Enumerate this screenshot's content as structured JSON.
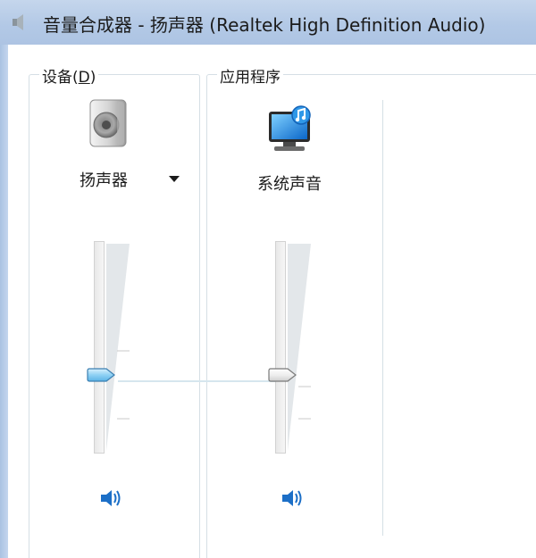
{
  "window": {
    "title": "音量合成器 - 扬声器 (Realtek High Definition Audio)"
  },
  "devices_group": {
    "label": "设备",
    "accelerator_open": "(",
    "accelerator_key": "D",
    "accelerator_close": ")",
    "device_name": "扬声器",
    "volume_percent": 36,
    "icon": "speaker-icon",
    "mute_icon": "volume-icon"
  },
  "apps_group": {
    "label": "应用程序",
    "apps": [
      {
        "name": "系统声音",
        "volume_percent": 36,
        "icon": "system-sounds-icon",
        "mute_icon": "volume-icon"
      }
    ]
  },
  "colors": {
    "titlebar": "#b3c9e6",
    "accent_thumb": "#5bb3e6",
    "mute_icon": "#1c6fc7"
  }
}
